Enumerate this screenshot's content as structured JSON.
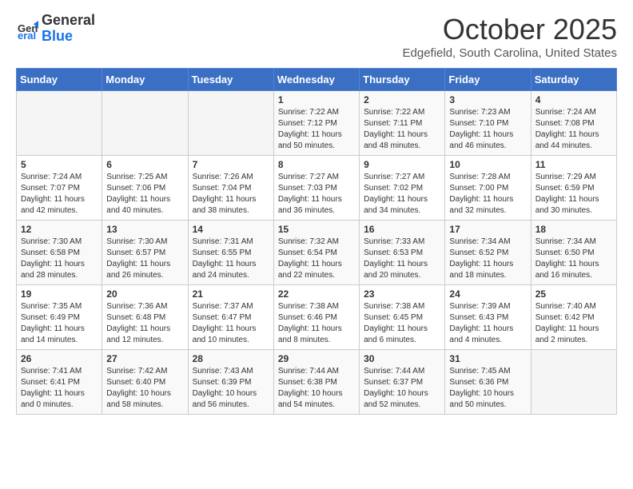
{
  "header": {
    "logo_general": "General",
    "logo_blue": "Blue",
    "month_title": "October 2025",
    "location": "Edgefield, South Carolina, United States"
  },
  "weekdays": [
    "Sunday",
    "Monday",
    "Tuesday",
    "Wednesday",
    "Thursday",
    "Friday",
    "Saturday"
  ],
  "weeks": [
    [
      {
        "day": "",
        "sunrise": "",
        "sunset": "",
        "daylight": ""
      },
      {
        "day": "",
        "sunrise": "",
        "sunset": "",
        "daylight": ""
      },
      {
        "day": "",
        "sunrise": "",
        "sunset": "",
        "daylight": ""
      },
      {
        "day": "1",
        "sunrise": "Sunrise: 7:22 AM",
        "sunset": "Sunset: 7:12 PM",
        "daylight": "Daylight: 11 hours and 50 minutes."
      },
      {
        "day": "2",
        "sunrise": "Sunrise: 7:22 AM",
        "sunset": "Sunset: 7:11 PM",
        "daylight": "Daylight: 11 hours and 48 minutes."
      },
      {
        "day": "3",
        "sunrise": "Sunrise: 7:23 AM",
        "sunset": "Sunset: 7:10 PM",
        "daylight": "Daylight: 11 hours and 46 minutes."
      },
      {
        "day": "4",
        "sunrise": "Sunrise: 7:24 AM",
        "sunset": "Sunset: 7:08 PM",
        "daylight": "Daylight: 11 hours and 44 minutes."
      }
    ],
    [
      {
        "day": "5",
        "sunrise": "Sunrise: 7:24 AM",
        "sunset": "Sunset: 7:07 PM",
        "daylight": "Daylight: 11 hours and 42 minutes."
      },
      {
        "day": "6",
        "sunrise": "Sunrise: 7:25 AM",
        "sunset": "Sunset: 7:06 PM",
        "daylight": "Daylight: 11 hours and 40 minutes."
      },
      {
        "day": "7",
        "sunrise": "Sunrise: 7:26 AM",
        "sunset": "Sunset: 7:04 PM",
        "daylight": "Daylight: 11 hours and 38 minutes."
      },
      {
        "day": "8",
        "sunrise": "Sunrise: 7:27 AM",
        "sunset": "Sunset: 7:03 PM",
        "daylight": "Daylight: 11 hours and 36 minutes."
      },
      {
        "day": "9",
        "sunrise": "Sunrise: 7:27 AM",
        "sunset": "Sunset: 7:02 PM",
        "daylight": "Daylight: 11 hours and 34 minutes."
      },
      {
        "day": "10",
        "sunrise": "Sunrise: 7:28 AM",
        "sunset": "Sunset: 7:00 PM",
        "daylight": "Daylight: 11 hours and 32 minutes."
      },
      {
        "day": "11",
        "sunrise": "Sunrise: 7:29 AM",
        "sunset": "Sunset: 6:59 PM",
        "daylight": "Daylight: 11 hours and 30 minutes."
      }
    ],
    [
      {
        "day": "12",
        "sunrise": "Sunrise: 7:30 AM",
        "sunset": "Sunset: 6:58 PM",
        "daylight": "Daylight: 11 hours and 28 minutes."
      },
      {
        "day": "13",
        "sunrise": "Sunrise: 7:30 AM",
        "sunset": "Sunset: 6:57 PM",
        "daylight": "Daylight: 11 hours and 26 minutes."
      },
      {
        "day": "14",
        "sunrise": "Sunrise: 7:31 AM",
        "sunset": "Sunset: 6:55 PM",
        "daylight": "Daylight: 11 hours and 24 minutes."
      },
      {
        "day": "15",
        "sunrise": "Sunrise: 7:32 AM",
        "sunset": "Sunset: 6:54 PM",
        "daylight": "Daylight: 11 hours and 22 minutes."
      },
      {
        "day": "16",
        "sunrise": "Sunrise: 7:33 AM",
        "sunset": "Sunset: 6:53 PM",
        "daylight": "Daylight: 11 hours and 20 minutes."
      },
      {
        "day": "17",
        "sunrise": "Sunrise: 7:34 AM",
        "sunset": "Sunset: 6:52 PM",
        "daylight": "Daylight: 11 hours and 18 minutes."
      },
      {
        "day": "18",
        "sunrise": "Sunrise: 7:34 AM",
        "sunset": "Sunset: 6:50 PM",
        "daylight": "Daylight: 11 hours and 16 minutes."
      }
    ],
    [
      {
        "day": "19",
        "sunrise": "Sunrise: 7:35 AM",
        "sunset": "Sunset: 6:49 PM",
        "daylight": "Daylight: 11 hours and 14 minutes."
      },
      {
        "day": "20",
        "sunrise": "Sunrise: 7:36 AM",
        "sunset": "Sunset: 6:48 PM",
        "daylight": "Daylight: 11 hours and 12 minutes."
      },
      {
        "day": "21",
        "sunrise": "Sunrise: 7:37 AM",
        "sunset": "Sunset: 6:47 PM",
        "daylight": "Daylight: 11 hours and 10 minutes."
      },
      {
        "day": "22",
        "sunrise": "Sunrise: 7:38 AM",
        "sunset": "Sunset: 6:46 PM",
        "daylight": "Daylight: 11 hours and 8 minutes."
      },
      {
        "day": "23",
        "sunrise": "Sunrise: 7:38 AM",
        "sunset": "Sunset: 6:45 PM",
        "daylight": "Daylight: 11 hours and 6 minutes."
      },
      {
        "day": "24",
        "sunrise": "Sunrise: 7:39 AM",
        "sunset": "Sunset: 6:43 PM",
        "daylight": "Daylight: 11 hours and 4 minutes."
      },
      {
        "day": "25",
        "sunrise": "Sunrise: 7:40 AM",
        "sunset": "Sunset: 6:42 PM",
        "daylight": "Daylight: 11 hours and 2 minutes."
      }
    ],
    [
      {
        "day": "26",
        "sunrise": "Sunrise: 7:41 AM",
        "sunset": "Sunset: 6:41 PM",
        "daylight": "Daylight: 11 hours and 0 minutes."
      },
      {
        "day": "27",
        "sunrise": "Sunrise: 7:42 AM",
        "sunset": "Sunset: 6:40 PM",
        "daylight": "Daylight: 10 hours and 58 minutes."
      },
      {
        "day": "28",
        "sunrise": "Sunrise: 7:43 AM",
        "sunset": "Sunset: 6:39 PM",
        "daylight": "Daylight: 10 hours and 56 minutes."
      },
      {
        "day": "29",
        "sunrise": "Sunrise: 7:44 AM",
        "sunset": "Sunset: 6:38 PM",
        "daylight": "Daylight: 10 hours and 54 minutes."
      },
      {
        "day": "30",
        "sunrise": "Sunrise: 7:44 AM",
        "sunset": "Sunset: 6:37 PM",
        "daylight": "Daylight: 10 hours and 52 minutes."
      },
      {
        "day": "31",
        "sunrise": "Sunrise: 7:45 AM",
        "sunset": "Sunset: 6:36 PM",
        "daylight": "Daylight: 10 hours and 50 minutes."
      },
      {
        "day": "",
        "sunrise": "",
        "sunset": "",
        "daylight": ""
      }
    ]
  ]
}
